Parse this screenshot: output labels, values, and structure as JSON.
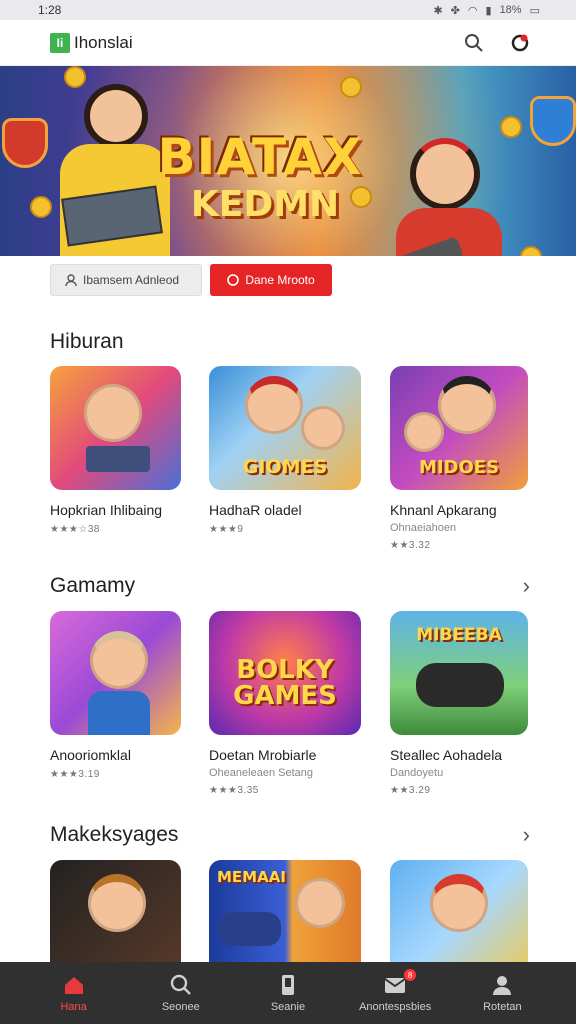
{
  "status_bar": {
    "time": "1:28",
    "battery": "18%"
  },
  "header": {
    "brand": "Ihonslai",
    "logo_text": "Ii"
  },
  "banner": {
    "title": "BIATAX",
    "subtitle": "KEDMN"
  },
  "buttons": {
    "secondary": "Ibamsem Adnleod",
    "primary": "Dane Mrooto"
  },
  "sections": [
    {
      "title": "Hiburan",
      "has_chevron": false,
      "items": [
        {
          "name": "Hopkrian Ihlibaing",
          "meta": "",
          "rating": "★★★☆38"
        },
        {
          "name": "HadhaR oladel",
          "meta": "",
          "rating": "★★★9"
        },
        {
          "name": "Khnanl Apkarang",
          "meta": "Ohnaeiahoen",
          "rating": "★★3.32"
        }
      ],
      "thumb_texts": [
        "",
        "GIOMES",
        "MIDOES"
      ]
    },
    {
      "title": "Gamamy",
      "has_chevron": true,
      "items": [
        {
          "name": "Anooriomklal",
          "meta": "",
          "rating": "★★★3.19"
        },
        {
          "name": "Doetan Mrobiarle",
          "meta": "Oheaneleaen Setang",
          "rating": "★★★3.35"
        },
        {
          "name": "Steallec Aohadela",
          "meta": "Dandoyetu",
          "rating": "★★3.29"
        }
      ],
      "thumb_texts": [
        "",
        "BOLKY GAMES",
        "MIBEEBA"
      ]
    },
    {
      "title": "Makeksyages",
      "has_chevron": true,
      "items": [],
      "thumb_texts": [
        "",
        "MEMAAI",
        ""
      ]
    }
  ],
  "navbar": [
    {
      "label": "Hana",
      "icon": "home-icon",
      "active": true
    },
    {
      "label": "Seonee",
      "icon": "search-icon",
      "active": false
    },
    {
      "label": "Seanie",
      "icon": "phone-icon",
      "active": false
    },
    {
      "label": "Anontespsbies",
      "icon": "notification-icon",
      "active": false,
      "badge": "8"
    },
    {
      "label": "Rotetan",
      "icon": "profile-icon",
      "active": false
    }
  ]
}
